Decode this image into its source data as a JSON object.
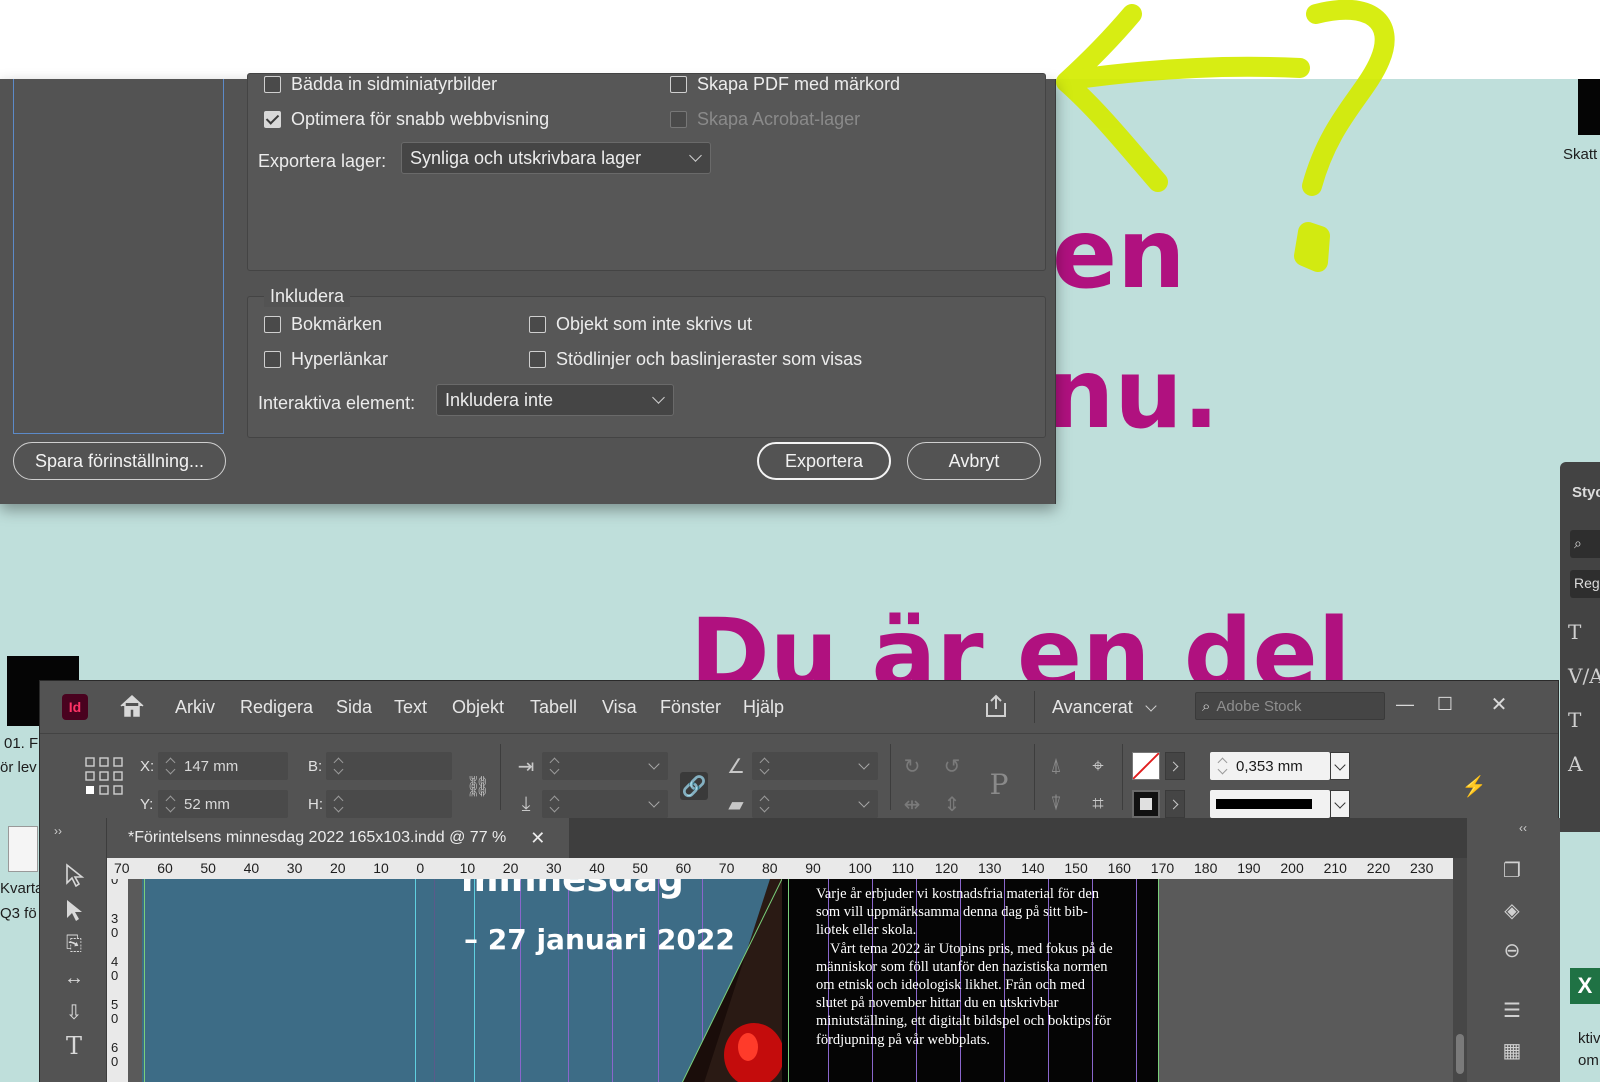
{
  "background": {
    "words": [
      "en",
      "nu.",
      "Du är en del"
    ],
    "accent_color": "#b0117f",
    "scribble_color": "#d4ec00",
    "desktop_labels": [
      "Skatt",
      "01. F",
      "ör lev",
      "Kvarta",
      "Q3 fö",
      "ktiv",
      "om"
    ]
  },
  "dialog": {
    "checkboxes_top": [
      {
        "label": "Bädda in sidminiatyrbilder",
        "checked": false,
        "disabled": false
      },
      {
        "label": "Skapa PDF med märkord",
        "checked": false,
        "disabled": false
      },
      {
        "label": "Optimera för snabb webbvisning",
        "checked": true,
        "disabled": false
      },
      {
        "label": "Skapa Acrobat-lager",
        "checked": false,
        "disabled": true
      }
    ],
    "layers_label": "Exportera lager:",
    "layers_value": "Synliga och utskrivbara lager",
    "include_title": "Inkludera",
    "include_checkboxes": [
      {
        "label": "Bokmärken",
        "checked": false
      },
      {
        "label": "Objekt som inte skrivs ut",
        "checked": false
      },
      {
        "label": "Hyperlänkar",
        "checked": false
      },
      {
        "label": "Stödlinjer och baslinjeraster som visas",
        "checked": false
      }
    ],
    "interactive_label": "Interaktiva element:",
    "interactive_value": "Inkludera inte",
    "save_preset_label": "Spara förinställning...",
    "export_label": "Exportera",
    "cancel_label": "Avbryt"
  },
  "styles_panel": {
    "tab": "Stycl",
    "search_icon": "search-icon",
    "style_value": "Regula"
  },
  "indesign": {
    "logo": "Id",
    "menu": [
      "Arkiv",
      "Redigera",
      "Sida",
      "Text",
      "Objekt",
      "Tabell",
      "Visa",
      "Fönster",
      "Hjälp"
    ],
    "workspace": "Avancerat",
    "stock_placeholder": "Adobe Stock",
    "control": {
      "x_label": "X:",
      "x_value": "147 mm",
      "y_label": "Y:",
      "y_value": "52 mm",
      "w_label": "B:",
      "h_label": "H:",
      "stroke_weight": "0,353 mm"
    },
    "doc_tab": "*Förintelsens minnesdag 2022 165x103.indd @ 77 %",
    "ruler_h": [
      "70",
      "60",
      "50",
      "40",
      "30",
      "20",
      "10",
      "0",
      "10",
      "20",
      "30",
      "40",
      "50",
      "60",
      "70",
      "80",
      "90",
      "100",
      "110",
      "120",
      "130",
      "140",
      "150",
      "160",
      "170",
      "180",
      "190",
      "200",
      "210",
      "220",
      "230"
    ],
    "ruler_v": [
      "0",
      "30",
      "40",
      "50",
      "60"
    ],
    "page": {
      "title_fragment": "minnesdag",
      "date": "– 27 januari 2022",
      "paragraphs": [
        "Varje år erbjuder vi kostnadsfria material för den som vill uppmärksamma denna dag på sitt bib-liotek eller skola.",
        "Vårt tema 2022 är Utopins pris, med fokus på de människor som föll utanför den nazistiska normen om etnisk och ideologisk likhet. Från och med slutet på november hittar du en utskrivbar miniutställning, ett digitalt bildspel och boktips för fördjupning på vår webbplats."
      ]
    }
  }
}
